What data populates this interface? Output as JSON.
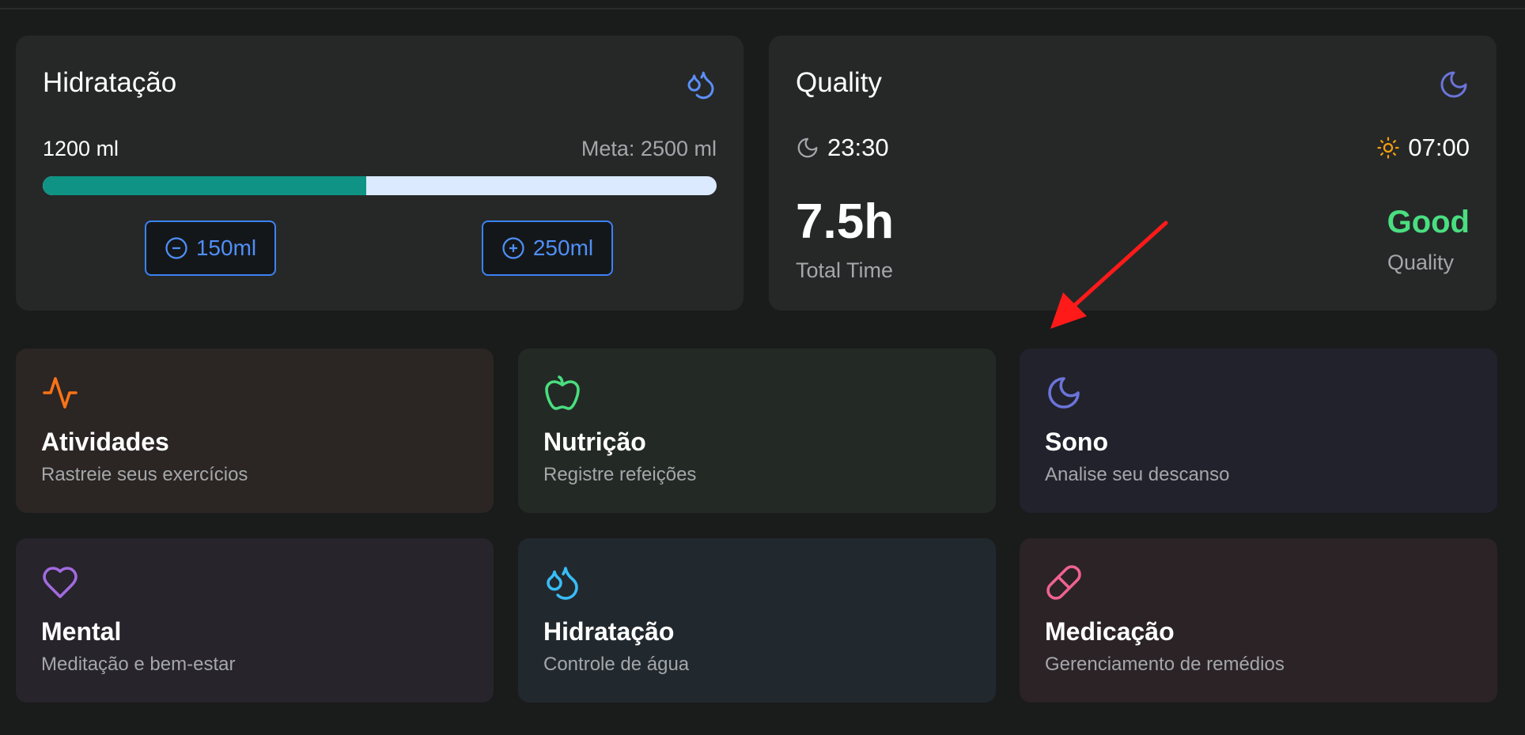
{
  "hydration": {
    "title": "Hidratação",
    "current": "1200 ml",
    "goal": "Meta: 2500 ml",
    "progress_fraction": 0.48,
    "minus_label": "150ml",
    "plus_label": "250ml",
    "icon": "droplets-icon"
  },
  "sleep": {
    "title": "Quality",
    "bedtime": "23:30",
    "waketime": "07:00",
    "total_hours": "7.5h",
    "total_label": "Total Time",
    "quality_value": "Good",
    "quality_label": "Quality",
    "icon": "moon-icon"
  },
  "tiles": [
    {
      "title": "Atividades",
      "description": "Rastreie seus exercícios",
      "icon": "activity-icon",
      "color": "#f97316"
    },
    {
      "title": "Nutrição",
      "description": "Registre refeições",
      "icon": "apple-icon",
      "color": "#4ade80"
    },
    {
      "title": "Sono",
      "description": "Analise seu descanso",
      "icon": "moon-icon",
      "color": "#6b74d9"
    },
    {
      "title": "Mental",
      "description": "Meditação e bem-estar",
      "icon": "heart-icon",
      "color": "#a26be0"
    },
    {
      "title": "Hidratação",
      "description": "Controle de água",
      "icon": "droplets-icon",
      "color": "#38bdf8"
    },
    {
      "title": "Medicação",
      "description": "Gerenciamento de remédios",
      "icon": "pill-icon",
      "color": "#f06292"
    }
  ],
  "colors": {
    "accent_blue": "#3b82f6",
    "progress": "#0e9384",
    "good": "#4ade80",
    "sun": "#f59e0b",
    "annotation": "#ff0000"
  }
}
